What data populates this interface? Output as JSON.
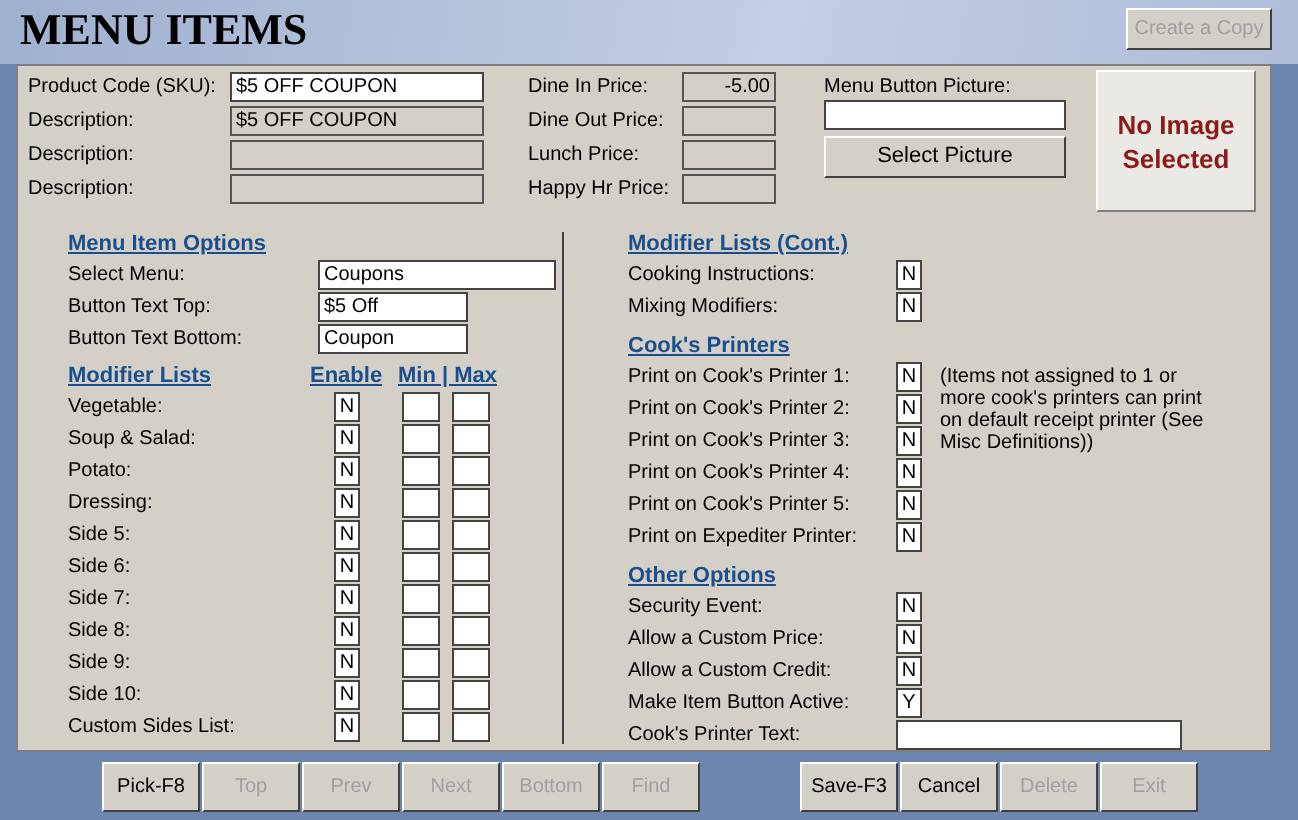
{
  "header": {
    "title": "MENU ITEMS",
    "copy_button": {
      "label": "Create a Copy",
      "disabled": true
    }
  },
  "identity": {
    "fields": [
      {
        "label": "Product Code (SKU):",
        "value": "$5 OFF COUPON",
        "disabled": false
      },
      {
        "label": "Description:",
        "value": "$5 OFF COUPON",
        "disabled": true
      },
      {
        "label": "Description:",
        "disabled": true
      },
      {
        "label": "Description:",
        "disabled": true
      }
    ]
  },
  "prices": [
    {
      "label": "Dine In Price:",
      "value": "-5.00"
    },
    {
      "label": "Dine Out Price:"
    },
    {
      "label": "Lunch Price:"
    },
    {
      "label": "Happy Hr Price:"
    }
  ],
  "picture": {
    "label": "Menu Button Picture:",
    "button": "Select Picture",
    "preview": "No Image Selected"
  },
  "menu_item_options": {
    "heading": "Menu Item Options",
    "fields": [
      {
        "label": "Select Menu:",
        "value": "Coupons",
        "kind": "wide"
      },
      {
        "label": "Button Text Top:",
        "value": "$5 Off",
        "kind": "narrow"
      },
      {
        "label": "Button Text Bottom:",
        "value": "Coupon",
        "kind": "narrow"
      }
    ]
  },
  "modifier_lists": {
    "heading": "Modifier Lists",
    "enable_heading": "Enable",
    "min_max_heading": "Min | Max",
    "rows": [
      {
        "label": "Vegetable:",
        "enable": "N"
      },
      {
        "label": "Soup & Salad:",
        "enable": "N"
      },
      {
        "label": "Potato:",
        "enable": "N"
      },
      {
        "label": "Dressing:",
        "enable": "N"
      },
      {
        "label": "Side 5:",
        "enable": "N"
      },
      {
        "label": "Side 6:",
        "enable": "N"
      },
      {
        "label": "Side 7:",
        "enable": "N"
      },
      {
        "label": "Side 8:",
        "enable": "N"
      },
      {
        "label": "Side 9:",
        "enable": "N"
      },
      {
        "label": "Side 10:",
        "enable": "N"
      },
      {
        "label": "Custom Sides List:",
        "enable": "N"
      }
    ]
  },
  "modifier_lists_cont": {
    "heading": "Modifier Lists (Cont.)",
    "rows": [
      {
        "label": "Cooking Instructions:",
        "value": "N"
      },
      {
        "label": "Mixing Modifiers:",
        "value": "N"
      }
    ]
  },
  "cooks_printers": {
    "heading": "Cook's Printers",
    "note": "(Items not assigned to 1 or more cook's printers can print on default receipt printer (See Misc Definitions))",
    "rows": [
      {
        "label": "Print on Cook's Printer 1:",
        "value": "N"
      },
      {
        "label": "Print on Cook's Printer 2:",
        "value": "N"
      },
      {
        "label": "Print on Cook's Printer 3:",
        "value": "N"
      },
      {
        "label": "Print on Cook's Printer 4:",
        "value": "N"
      },
      {
        "label": "Print on Cook's Printer 5:",
        "value": "N"
      },
      {
        "label": "Print on Expediter Printer:",
        "value": "N"
      }
    ]
  },
  "other_options": {
    "heading": "Other Options",
    "rows": [
      {
        "label": "Security Event:",
        "kind": "flag",
        "value": "N"
      },
      {
        "label": "Allow a Custom Price:",
        "kind": "flag",
        "value": "N"
      },
      {
        "label": "Allow a Custom Credit:",
        "kind": "flag",
        "value": "N"
      },
      {
        "label": "Make Item Button Active:",
        "kind": "flag",
        "value": "Y"
      },
      {
        "label": "Cook's Printer Text:",
        "kind": "text"
      }
    ]
  },
  "toolbar": {
    "left": [
      {
        "label": "Pick-F8",
        "disabled": false
      },
      {
        "label": "Top",
        "disabled": true
      },
      {
        "label": "Prev",
        "disabled": true
      },
      {
        "label": "Next",
        "disabled": true
      },
      {
        "label": "Bottom",
        "disabled": true
      },
      {
        "label": "Find",
        "disabled": true
      }
    ],
    "right": [
      {
        "label": "Save-F3",
        "disabled": false
      },
      {
        "label": "Cancel",
        "disabled": false
      },
      {
        "label": "Delete",
        "disabled": true
      },
      {
        "label": "Exit",
        "disabled": true
      }
    ]
  }
}
